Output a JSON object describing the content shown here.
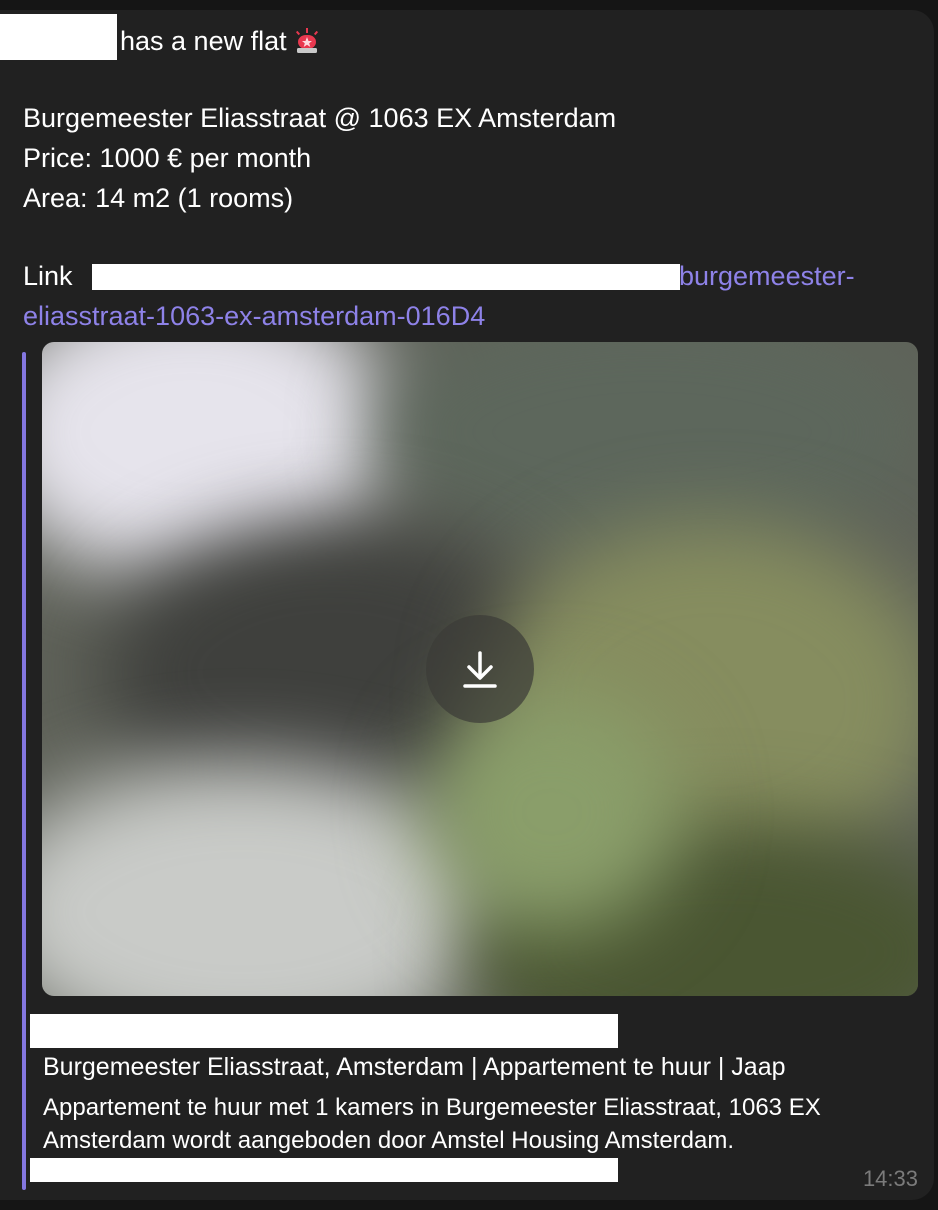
{
  "message": {
    "header_text": "has a new flat",
    "header_emoji_icon": "police-siren-icon",
    "address": "Burgemeester Eliasstraat @ 1063 EX Amsterdam",
    "price_label": "Price:",
    "price_value": "1000 € per month",
    "area_label": "Area:",
    "area_value": "14 m2 (1 rooms)",
    "link_label": "Link",
    "link_tail_line1": "burgemeester-",
    "link_tail_line2": "eliasstraat-1063-ex-amsterdam-016D4",
    "timestamp": "14:33"
  },
  "preview": {
    "title": "Burgemeester Eliasstraat, Amsterdam | Appartement te huur | Jaap",
    "description": "Appartement te huur met 1 kamers in Burgemeester Eliasstraat, 1063 EX Amsterdam wordt aangeboden door Amstel Housing Amsterdam.",
    "download_icon": "download-icon"
  },
  "colors": {
    "bubble_background": "#212121",
    "link": "#8e82e8",
    "preview_accent": "#8477e0",
    "timestamp": "#7b7b7b"
  }
}
